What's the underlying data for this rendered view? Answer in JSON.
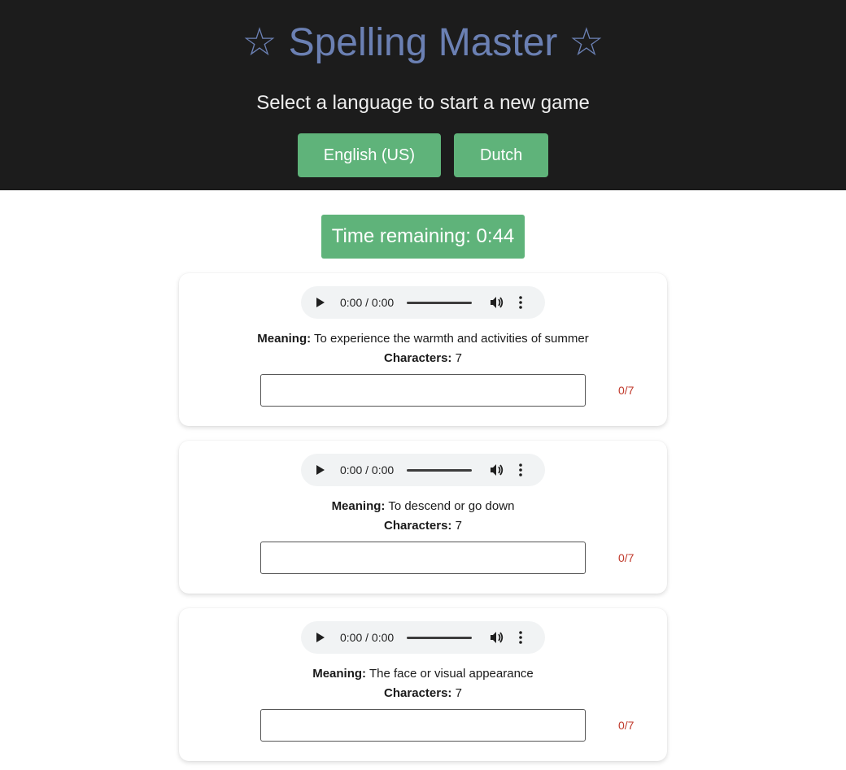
{
  "header": {
    "title": "Spelling Master",
    "star_glyph": "☆",
    "subtitle": "Select a language to start a new game",
    "languages": [
      "English (US)",
      "Dutch"
    ]
  },
  "timer": {
    "text": "Time remaining: 0:44"
  },
  "cards": [
    {
      "audio_time": "0:00 / 0:00",
      "meaning_label": "Meaning:",
      "meaning": "To experience the warmth and activities of summer",
      "chars_label": "Characters:",
      "chars": "7",
      "input_value": "",
      "count": "0/7"
    },
    {
      "audio_time": "0:00 / 0:00",
      "meaning_label": "Meaning:",
      "meaning": "To descend or go down",
      "chars_label": "Characters:",
      "chars": "7",
      "input_value": "",
      "count": "0/7"
    },
    {
      "audio_time": "0:00 / 0:00",
      "meaning_label": "Meaning:",
      "meaning": "The face or visual appearance",
      "chars_label": "Characters:",
      "chars": "7",
      "input_value": "",
      "count": "0/7"
    }
  ],
  "icons": {
    "play": "play-icon",
    "volume": "volume-icon",
    "more": "more-options-icon"
  },
  "colors": {
    "header_bg": "#1c1c1c",
    "title": "#6b80b3",
    "accent_green": "#5fb37a",
    "count_red": "#c0392b"
  }
}
